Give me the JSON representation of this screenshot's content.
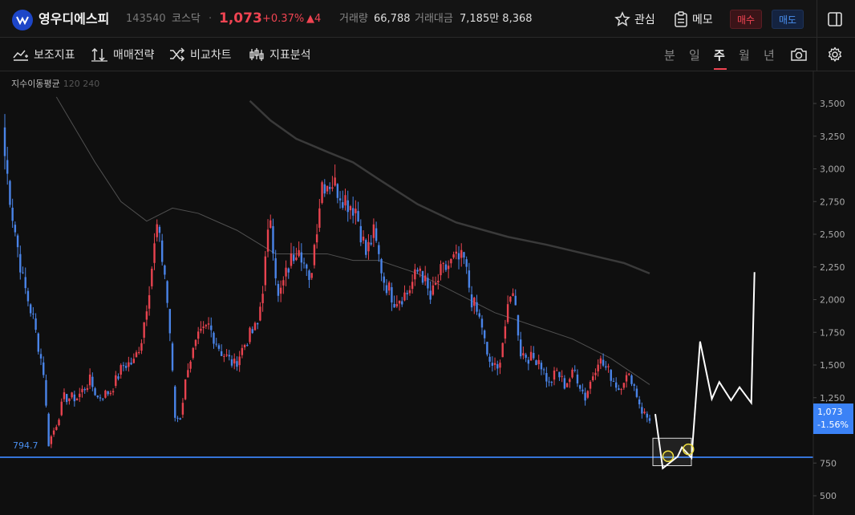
{
  "header": {
    "name": "영우디에스피",
    "code": "143540",
    "market": "코스닥",
    "separator": "·",
    "price": "1,073",
    "change_pct": "+0.37%",
    "change_amt": "▲4",
    "volume_label": "거래량",
    "volume_value": "66,788",
    "amount_label": "거래대금",
    "amount_value": "7,185만 8,368",
    "watch_label": "관심",
    "memo_label": "메모",
    "buy_label": "매수",
    "sell_label": "매도"
  },
  "toolbar": {
    "indicator_label": "보조지표",
    "strategy_label": "매매전략",
    "compare_label": "비교차트",
    "analysis_label": "지표분석",
    "periods": [
      "분",
      "일",
      "주",
      "월",
      "년"
    ],
    "active_period": "주"
  },
  "colors": {
    "up": "#e8434f",
    "down": "#4a84e8",
    "level": "#3b82f6",
    "ma120": "#3a3a3a",
    "ma240": "#505050",
    "projection": "#ffffff",
    "marker": "#f0e040"
  },
  "chart_data": {
    "type": "candlestick",
    "title": "",
    "indicator_label": "지수이동평균",
    "indicator_periods": "120 240",
    "y_ticks": [
      "3,500",
      "3,250",
      "3,000",
      "2,750",
      "2,500",
      "2,250",
      "2,000",
      "1,750",
      "1,500",
      "1,250",
      "750",
      "500"
    ],
    "y_tick_values": [
      3500,
      3250,
      3000,
      2750,
      2500,
      2250,
      2000,
      1750,
      1500,
      1250,
      750,
      500
    ],
    "ylim": [
      420,
      3700
    ],
    "support_level": 794.7,
    "support_label": "794.7",
    "current_price_label": "1,073",
    "current_change_label": "-1.56%",
    "close_anchors": [
      [
        0,
        3100
      ],
      [
        3,
        2650
      ],
      [
        7,
        2150
      ],
      [
        11,
        1850
      ],
      [
        15,
        1450
      ],
      [
        17,
        900
      ],
      [
        20,
        1050
      ],
      [
        23,
        1250
      ],
      [
        28,
        1250
      ],
      [
        33,
        1380
      ],
      [
        36,
        1250
      ],
      [
        41,
        1300
      ],
      [
        46,
        1500
      ],
      [
        50,
        1520
      ],
      [
        53,
        1700
      ],
      [
        56,
        2100
      ],
      [
        59,
        2550
      ],
      [
        62,
        2200
      ],
      [
        64,
        1750
      ],
      [
        66,
        1100
      ],
      [
        68,
        1100
      ],
      [
        71,
        1500
      ],
      [
        75,
        1700
      ],
      [
        79,
        1800
      ],
      [
        84,
        1600
      ],
      [
        89,
        1500
      ],
      [
        94,
        1700
      ],
      [
        98,
        1800
      ],
      [
        100,
        2100
      ],
      [
        103,
        2650
      ],
      [
        106,
        2000
      ],
      [
        110,
        2250
      ],
      [
        114,
        2450
      ],
      [
        118,
        2100
      ],
      [
        123,
        2900
      ],
      [
        127,
        2900
      ],
      [
        133,
        2750
      ],
      [
        136,
        2700
      ],
      [
        140,
        2350
      ],
      [
        143,
        2500
      ],
      [
        147,
        2150
      ],
      [
        151,
        2000
      ],
      [
        156,
        2050
      ],
      [
        161,
        2250
      ],
      [
        165,
        2000
      ],
      [
        169,
        2200
      ],
      [
        174,
        2300
      ],
      [
        178,
        2300
      ],
      [
        181,
        2000
      ],
      [
        185,
        1800
      ],
      [
        187,
        1550
      ],
      [
        191,
        1450
      ],
      [
        194,
        1800
      ],
      [
        197,
        2100
      ],
      [
        200,
        1600
      ],
      [
        204,
        1550
      ],
      [
        207,
        1550
      ],
      [
        211,
        1350
      ],
      [
        214,
        1450
      ],
      [
        217,
        1350
      ],
      [
        221,
        1450
      ],
      [
        225,
        1250
      ],
      [
        230,
        1550
      ],
      [
        234,
        1450
      ],
      [
        238,
        1320
      ],
      [
        240,
        1400
      ],
      [
        243,
        1400
      ],
      [
        247,
        1150
      ],
      [
        250,
        1073
      ]
    ],
    "candle_count": 251,
    "ma120": [
      [
        95,
        3520
      ],
      [
        103,
        3370
      ],
      [
        113,
        3230
      ],
      [
        125,
        3130
      ],
      [
        135,
        3050
      ],
      [
        145,
        2920
      ],
      [
        160,
        2730
      ],
      [
        175,
        2590
      ],
      [
        195,
        2480
      ],
      [
        210,
        2420
      ],
      [
        225,
        2350
      ],
      [
        240,
        2280
      ],
      [
        250,
        2200
      ]
    ],
    "ma240": [
      [
        20,
        3550
      ],
      [
        35,
        3050
      ],
      [
        45,
        2750
      ],
      [
        55,
        2600
      ],
      [
        65,
        2700
      ],
      [
        75,
        2660
      ],
      [
        90,
        2530
      ],
      [
        105,
        2350
      ],
      [
        115,
        2350
      ],
      [
        125,
        2350
      ],
      [
        135,
        2300
      ],
      [
        145,
        2300
      ],
      [
        160,
        2200
      ],
      [
        175,
        2050
      ],
      [
        190,
        1900
      ],
      [
        205,
        1800
      ],
      [
        220,
        1700
      ],
      [
        235,
        1550
      ],
      [
        250,
        1350
      ]
    ],
    "projection": [
      [
        0,
        1125
      ],
      [
        0.7,
        710
      ],
      [
        2.1,
        800
      ],
      [
        2.5,
        870
      ],
      [
        3.4,
        790
      ],
      [
        4.2,
        1680
      ],
      [
        5.3,
        1240
      ],
      [
        6.0,
        1370
      ],
      [
        7.1,
        1230
      ],
      [
        7.9,
        1330
      ],
      [
        9.0,
        1210
      ],
      [
        9.3,
        2210
      ]
    ],
    "markers": [
      [
        1.2,
        802
      ],
      [
        3.1,
        855
      ]
    ]
  }
}
